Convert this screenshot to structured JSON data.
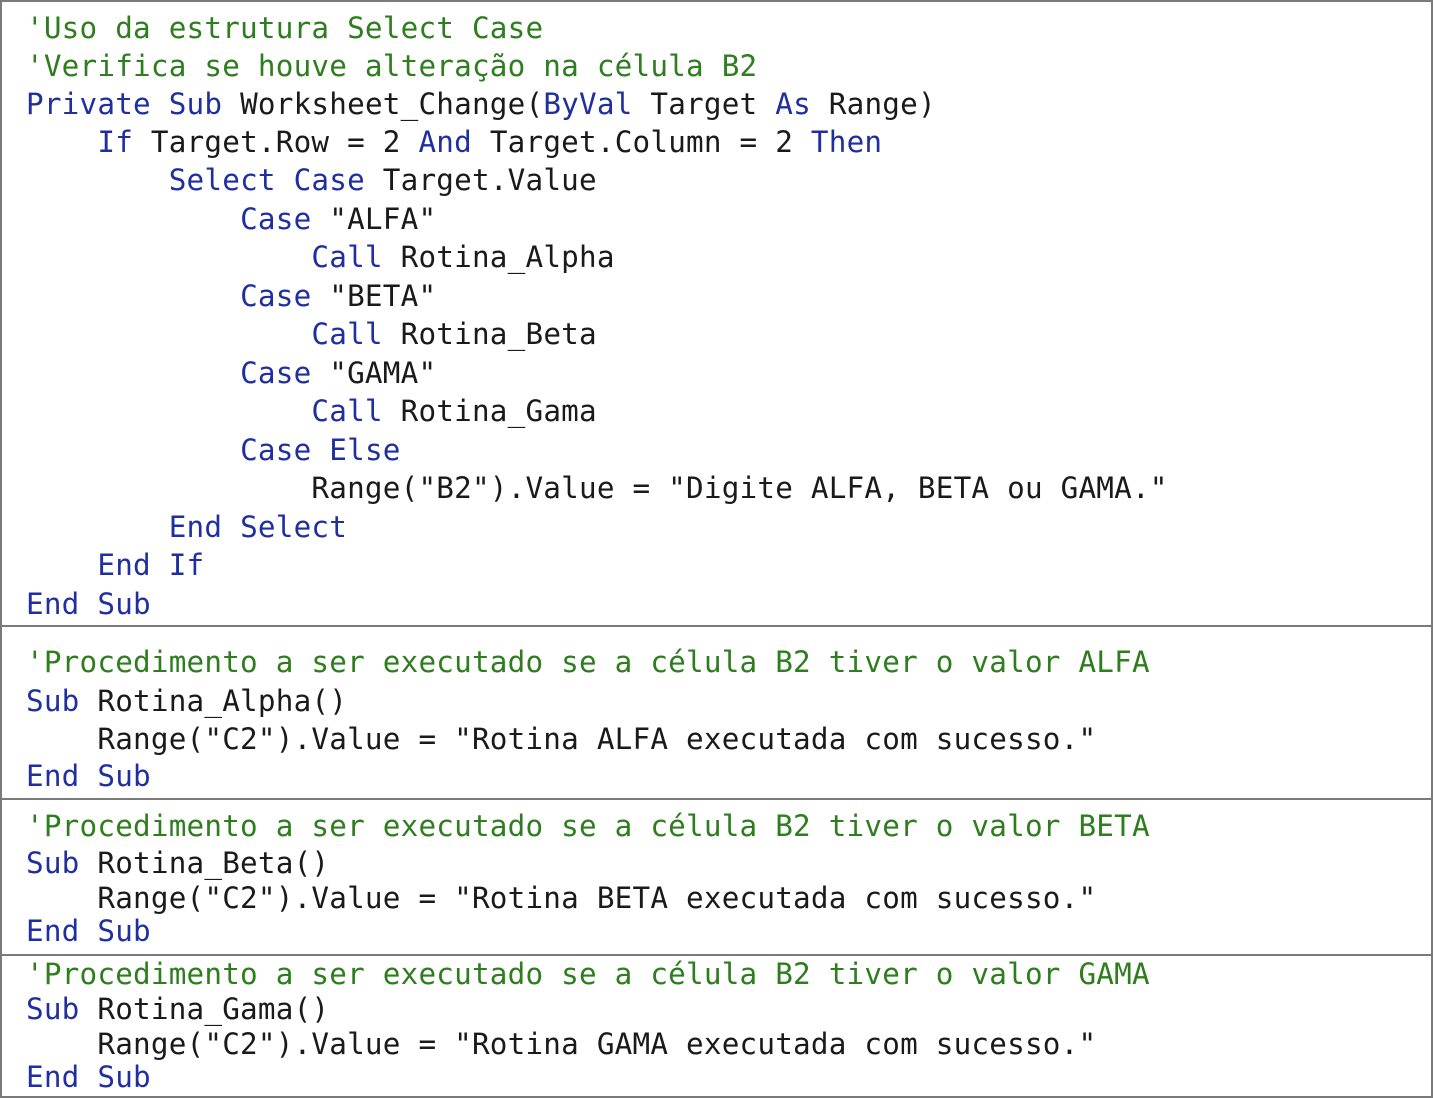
{
  "colors": {
    "comment": "#2e7d1e",
    "keyword": "#1f2fa0",
    "text": "#1a1a1a",
    "border": "#7a7a7a"
  },
  "blocks": [
    {
      "lines": [
        [
          [
            "cm",
            "'Uso da estrutura Select Case"
          ]
        ],
        [
          [
            "cm",
            "'Verifica se houve alteração na célula B2"
          ]
        ],
        [
          [
            "kw",
            "Private"
          ],
          [
            "tx",
            " "
          ],
          [
            "kw",
            "Sub"
          ],
          [
            "tx",
            " Worksheet_Change("
          ],
          [
            "kw",
            "ByVal"
          ],
          [
            "tx",
            " Target "
          ],
          [
            "kw",
            "As"
          ],
          [
            "tx",
            " Range)"
          ]
        ],
        [
          [
            "tx",
            "    "
          ],
          [
            "kw",
            "If"
          ],
          [
            "tx",
            " Target.Row = 2 "
          ],
          [
            "kw",
            "And"
          ],
          [
            "tx",
            " Target.Column = 2 "
          ],
          [
            "kw",
            "Then"
          ]
        ],
        [
          [
            "tx",
            "        "
          ],
          [
            "kw",
            "Select"
          ],
          [
            "tx",
            " "
          ],
          [
            "kw",
            "Case"
          ],
          [
            "tx",
            " Target.Value"
          ]
        ],
        [
          [
            "tx",
            "            "
          ],
          [
            "kw",
            "Case"
          ],
          [
            "tx",
            " \"ALFA\""
          ]
        ],
        [
          [
            "tx",
            "                "
          ],
          [
            "kw",
            "Call"
          ],
          [
            "tx",
            " Rotina_Alpha"
          ]
        ],
        [
          [
            "tx",
            "            "
          ],
          [
            "kw",
            "Case"
          ],
          [
            "tx",
            " \"BETA\""
          ]
        ],
        [
          [
            "tx",
            "                "
          ],
          [
            "kw",
            "Call"
          ],
          [
            "tx",
            " Rotina_Beta"
          ]
        ],
        [
          [
            "tx",
            "            "
          ],
          [
            "kw",
            "Case"
          ],
          [
            "tx",
            " \"GAMA\""
          ]
        ],
        [
          [
            "tx",
            "                "
          ],
          [
            "kw",
            "Call"
          ],
          [
            "tx",
            " Rotina_Gama"
          ]
        ],
        [
          [
            "tx",
            "            "
          ],
          [
            "kw",
            "Case"
          ],
          [
            "tx",
            " "
          ],
          [
            "kw",
            "Else"
          ]
        ],
        [
          [
            "tx",
            "                Range(\"B2\").Value = \"Digite ALFA, BETA ou GAMA.\""
          ]
        ],
        [
          [
            "tx",
            "        "
          ],
          [
            "kw",
            "End"
          ],
          [
            "tx",
            " "
          ],
          [
            "kw",
            "Select"
          ]
        ],
        [
          [
            "tx",
            "    "
          ],
          [
            "kw",
            "End"
          ],
          [
            "tx",
            " "
          ],
          [
            "kw",
            "If"
          ]
        ],
        [
          [
            "kw",
            "End"
          ],
          [
            "tx",
            " "
          ],
          [
            "kw",
            "Sub"
          ]
        ]
      ]
    },
    {
      "lines": [
        [
          [
            "cm",
            "'Procedimento a ser executado se a célula B2 tiver o valor ALFA"
          ]
        ],
        [
          [
            "kw",
            "Sub"
          ],
          [
            "tx",
            " Rotina_Alpha()"
          ]
        ],
        [
          [
            "tx",
            "    Range(\"C2\").Value = \"Rotina ALFA executada com sucesso.\""
          ]
        ],
        [
          [
            "kw",
            "End"
          ],
          [
            "tx",
            " "
          ],
          [
            "kw",
            "Sub"
          ]
        ]
      ]
    },
    {
      "lines": [
        [
          [
            "cm",
            "'Procedimento a ser executado se a célula B2 tiver o valor BETA"
          ]
        ],
        [
          [
            "kw",
            "Sub"
          ],
          [
            "tx",
            " Rotina_Beta()"
          ]
        ],
        [
          [
            "tx",
            "    Range(\"C2\").Value = \"Rotina BETA executada com sucesso.\""
          ]
        ],
        [
          [
            "kw",
            "End"
          ],
          [
            "tx",
            " "
          ],
          [
            "kw",
            "Sub"
          ]
        ]
      ]
    },
    {
      "lines": [
        [
          [
            "cm",
            "'Procedimento a ser executado se a célula B2 tiver o valor GAMA"
          ]
        ],
        [
          [
            "kw",
            "Sub"
          ],
          [
            "tx",
            " Rotina_Gama()"
          ]
        ],
        [
          [
            "tx",
            "    Range(\"C2\").Value = \"Rotina GAMA executada com sucesso.\""
          ]
        ],
        [
          [
            "kw",
            "End"
          ],
          [
            "tx",
            " "
          ],
          [
            "kw",
            "Sub"
          ]
        ]
      ]
    }
  ]
}
